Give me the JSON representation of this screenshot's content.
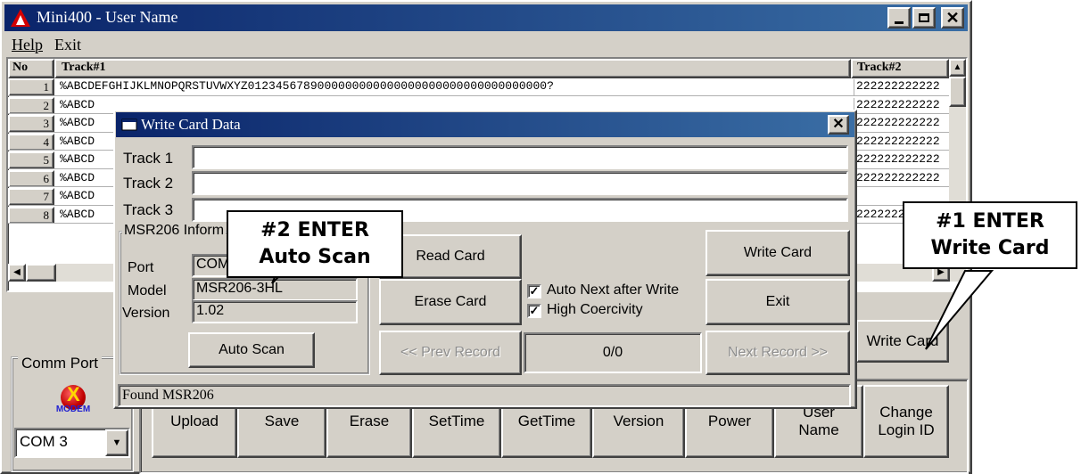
{
  "main_window": {
    "title": "Mini400  -  User Name",
    "menu": [
      "Help",
      "Exit"
    ],
    "grid": {
      "columns": [
        "No",
        "Track#1",
        "Track#2"
      ],
      "rows": [
        {
          "no": "1",
          "track1": "%ABCDEFGHIJKLMNOPQRSTUVWXYZ0123456789000000000000000000000000000000000?",
          "track2": "222222222222"
        },
        {
          "no": "2",
          "track1": "%ABCD",
          "track2": "222222222222"
        },
        {
          "no": "3",
          "track1": "%ABCD",
          "track2": "222222222222"
        },
        {
          "no": "4",
          "track1": "%ABCD",
          "track2": "222222222222"
        },
        {
          "no": "5",
          "track1": "%ABCD",
          "track2": "222222222222"
        },
        {
          "no": "6",
          "track1": "%ABCD",
          "track2": "222222222222"
        },
        {
          "no": "7",
          "track1": "%ABCD",
          "track2": ""
        },
        {
          "no": "8",
          "track1": "%ABCD",
          "track2": "222222222222"
        }
      ]
    },
    "comm_port_label": "Comm Port",
    "modem_icon_text": "MODEM",
    "com_port_value": "COM 3",
    "write_card_label": "Write Card",
    "toolbar": [
      "Upload",
      "Save",
      "Erase",
      "SetTime",
      "GetTime",
      "Version",
      "Power",
      "User Name",
      "Change Login ID"
    ]
  },
  "dialog": {
    "title": "Write Card Data",
    "track_labels": [
      "Track 1",
      "Track 2",
      "Track 3"
    ],
    "track_values": [
      "",
      "",
      ""
    ],
    "msr_group_label": "MSR206 Inform",
    "port_label": "Port",
    "port_value": "COM",
    "model_label": "Model",
    "model_value": "MSR206-3HL",
    "version_label": "Version",
    "version_value": "1.02",
    "auto_scan": "Auto Scan",
    "read_card": "Read Card",
    "erase_card": "Erase Card",
    "write_card": "Write Card",
    "exit": "Exit",
    "check_auto_next": "Auto Next after Write",
    "check_high_coercivity": "High Coercivity",
    "prev_record": "<< Prev Record",
    "record_count": "0/0",
    "next_record": "Next Record >>",
    "status": "Found MSR206"
  },
  "callouts": {
    "c2_line1": "#2  ENTER",
    "c2_line2": "Auto Scan",
    "c1_line1": "#1  ENTER",
    "c1_line2": "Write Card"
  }
}
